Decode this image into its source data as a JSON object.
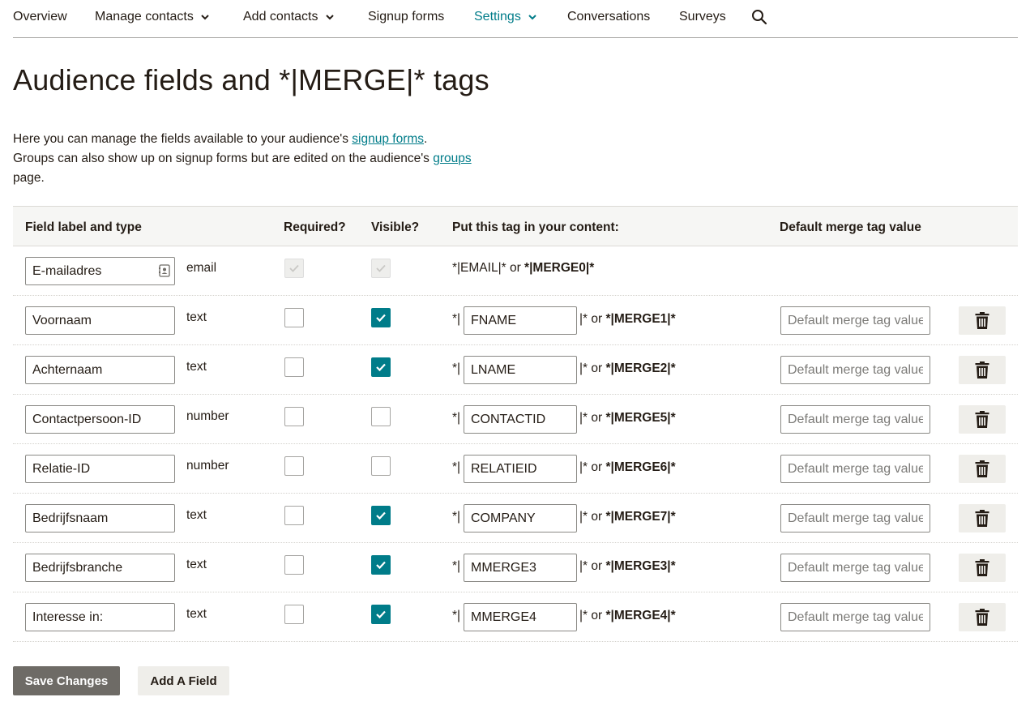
{
  "nav": {
    "items": [
      {
        "label": "Overview",
        "dropdown": false,
        "active": false
      },
      {
        "label": "Manage contacts",
        "dropdown": true,
        "active": false
      },
      {
        "label": "Add contacts",
        "dropdown": true,
        "active": false
      },
      {
        "label": "Signup forms",
        "dropdown": false,
        "active": false
      },
      {
        "label": "Settings",
        "dropdown": true,
        "active": true
      },
      {
        "label": "Conversations",
        "dropdown": false,
        "active": false
      },
      {
        "label": "Surveys",
        "dropdown": false,
        "active": false
      }
    ],
    "search_icon": "search-icon"
  },
  "page": {
    "title": "Audience fields and *|MERGE|* tags",
    "intro": {
      "line1_pre": "Here you can manage the fields available to your audience's ",
      "line1_link": "signup forms",
      "line1_post": ".",
      "line2_pre": "Groups can also show up on signup forms but are edited on the audience's ",
      "line2_link": "groups",
      "line2_post": "page."
    }
  },
  "table": {
    "headers": {
      "field": "Field label and type",
      "required": "Required?",
      "visible": "Visible?",
      "tag": "Put this tag in your content:",
      "default": "Default merge tag value"
    },
    "tag_prefix": "*|",
    "tag_suffix_pre": "|* or ",
    "or_text": " or ",
    "default_placeholder": "Default merge tag value",
    "email_row": {
      "label": "E-mailadres",
      "type": "email",
      "tag": "*|EMAIL|*",
      "merge": "*|MERGE0|*",
      "required": true,
      "visible": true
    },
    "rows": [
      {
        "label": "Voornaam",
        "type": "text",
        "required": false,
        "visible": true,
        "tag": "FNAME",
        "merge": "*|MERGE1|*"
      },
      {
        "label": "Achternaam",
        "type": "text",
        "required": false,
        "visible": true,
        "tag": "LNAME",
        "merge": "*|MERGE2|*"
      },
      {
        "label": "Contactpersoon-ID",
        "type": "number",
        "required": false,
        "visible": false,
        "tag": "CONTACTID",
        "merge": "*|MERGE5|*"
      },
      {
        "label": "Relatie-ID",
        "type": "number",
        "required": false,
        "visible": false,
        "tag": "RELATIEID",
        "merge": "*|MERGE6|*"
      },
      {
        "label": "Bedrijfsnaam",
        "type": "text",
        "required": false,
        "visible": true,
        "tag": "COMPANY",
        "merge": "*|MERGE7|*"
      },
      {
        "label": "Bedrijfsbranche",
        "type": "text",
        "required": false,
        "visible": true,
        "tag": "MMERGE3",
        "merge": "*|MERGE3|*"
      },
      {
        "label": "Interesse in:",
        "type": "text",
        "required": false,
        "visible": true,
        "tag": "MMERGE4",
        "merge": "*|MERGE4|*"
      }
    ]
  },
  "footer": {
    "save_label": "Save Changes",
    "add_label": "Add A Field"
  },
  "colors": {
    "accent": "#007c89",
    "text": "#241c15",
    "save_bg": "#6e6b66",
    "secondary_bg": "#efeeea"
  }
}
